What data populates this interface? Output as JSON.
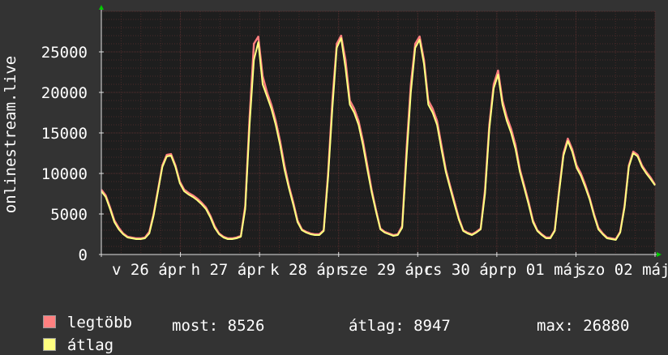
{
  "chart_data": {
    "type": "line",
    "ylabel": "onlinestream.live",
    "ylim": [
      0,
      30000
    ],
    "y_ticks": [
      0,
      5000,
      10000,
      15000,
      20000,
      25000
    ],
    "y_tick_labels": [
      "0",
      "5000",
      "10000",
      "15000",
      "20000",
      "25000"
    ],
    "x_tick_labels": [
      "v 26 ápr",
      "h 27 ápr",
      "k 28 ápr",
      "sze 29 ápr",
      "cs 30 ápr",
      "p 01 máj",
      "szo 02 máj"
    ],
    "grid": true,
    "legend_placement": "bottom-left",
    "colors": {
      "background": "#333333",
      "plot_background": "#1e1e1e",
      "grid_minor": "#4a2a2a",
      "grid_major": "#5a3030",
      "axis": "#e0e0e0",
      "arrow": "#00cc00",
      "series_max": "#ff8080",
      "series_avg": "#ffff80"
    },
    "series": [
      {
        "name": "legtöbb",
        "color": "#ff8080",
        "values": [
          8000,
          7300,
          5800,
          4200,
          3300,
          2600,
          2200,
          2100,
          2000,
          2000,
          2100,
          2800,
          5000,
          8000,
          11000,
          12300,
          12400,
          11000,
          9000,
          8000,
          7600,
          7300,
          6900,
          6400,
          5800,
          4800,
          3500,
          2600,
          2200,
          2000,
          2000,
          2100,
          2300,
          6000,
          17000,
          26000,
          26880,
          22000,
          20000,
          18500,
          16500,
          14000,
          11000,
          8500,
          6500,
          4200,
          3100,
          2800,
          2600,
          2500,
          2500,
          3000,
          10000,
          19000,
          26000,
          27000,
          24000,
          19000,
          18000,
          16500,
          14000,
          11000,
          8000,
          5500,
          3200,
          2800,
          2600,
          2400,
          2500,
          3500,
          13000,
          21000,
          26000,
          26900,
          24000,
          19000,
          18000,
          16500,
          13500,
          10500,
          8500,
          6500,
          4500,
          3000,
          2700,
          2500,
          2800,
          3200,
          8000,
          16000,
          21000,
          22700,
          19000,
          17000,
          15500,
          13500,
          10500,
          8500,
          6500,
          4200,
          3000,
          2500,
          2100,
          2100,
          3000,
          8000,
          12500,
          14300,
          13000,
          11000,
          10000,
          8600,
          7000,
          5000,
          3300,
          2600,
          2100,
          2000,
          1900,
          2800,
          6000,
          11000,
          12700,
          12300,
          11000,
          10200,
          9500,
          8600
        ]
      },
      {
        "name": "átlag",
        "color": "#ffff80",
        "values": [
          7800,
          7100,
          5600,
          4000,
          3100,
          2500,
          2100,
          2000,
          1900,
          1900,
          2000,
          2600,
          4800,
          7800,
          10800,
          12100,
          12200,
          10800,
          8800,
          7800,
          7400,
          7100,
          6700,
          6200,
          5600,
          4600,
          3300,
          2500,
          2100,
          1900,
          1900,
          2000,
          2200,
          5600,
          16000,
          24000,
          26200,
          21000,
          19500,
          18000,
          16000,
          13500,
          10500,
          8200,
          6200,
          4000,
          3000,
          2700,
          2500,
          2400,
          2400,
          2900,
          9500,
          18000,
          25500,
          26700,
          23000,
          18500,
          17500,
          16000,
          13500,
          10500,
          7700,
          5300,
          3100,
          2700,
          2500,
          2300,
          2400,
          3300,
          12000,
          20000,
          25500,
          26500,
          23500,
          18500,
          17500,
          16000,
          13000,
          10200,
          8200,
          6200,
          4300,
          2900,
          2600,
          2400,
          2700,
          3100,
          7500,
          15500,
          20500,
          22200,
          18500,
          16500,
          15000,
          13000,
          10200,
          8200,
          6200,
          4000,
          2900,
          2400,
          2000,
          2000,
          2900,
          7700,
          12200,
          14000,
          12700,
          10700,
          9700,
          8300,
          6800,
          4800,
          3100,
          2500,
          2000,
          1900,
          1800,
          2700,
          5800,
          10800,
          12500,
          12100,
          10800,
          10000,
          9300,
          8526
        ]
      }
    ],
    "legend": [
      {
        "name": "legtöbb",
        "color": "#ff8080"
      },
      {
        "name": "átlag",
        "color": "#ffff80"
      }
    ],
    "stats": {
      "now_label": "most:",
      "now_value": "8526",
      "avg_label": "átlag:",
      "avg_value": "8947",
      "max_label": "max:",
      "max_value": "26880"
    }
  }
}
